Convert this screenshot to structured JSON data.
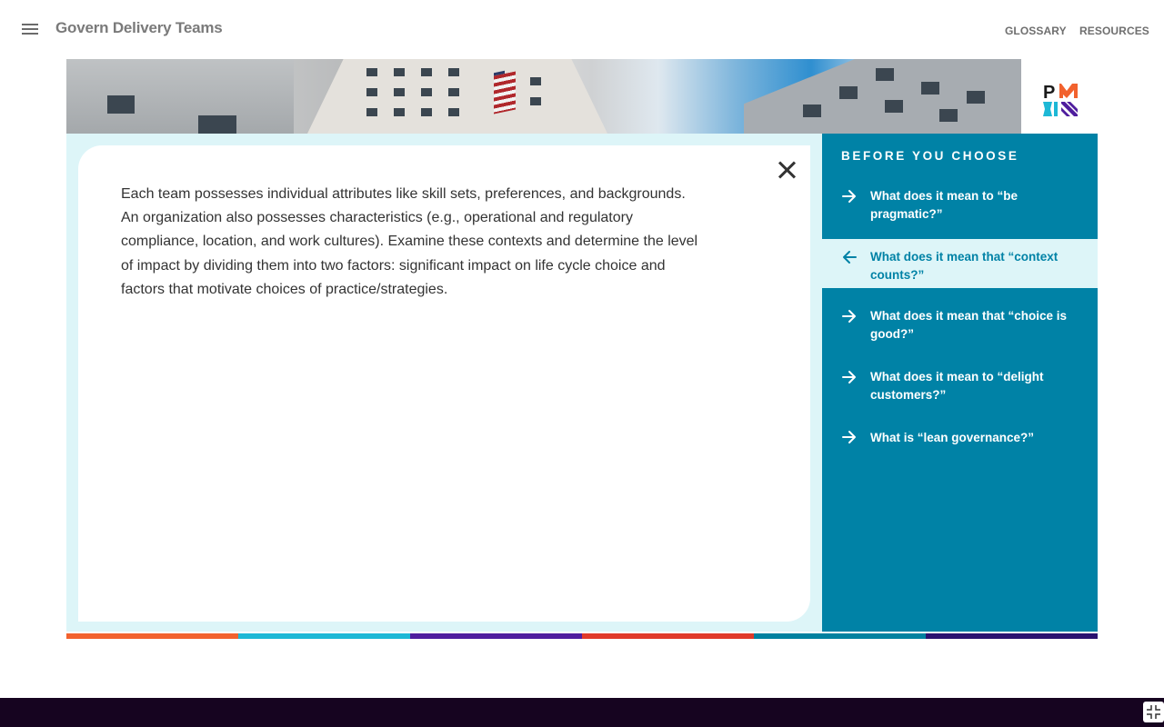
{
  "header": {
    "title": "Govern Delivery Teams",
    "menu_icon": "hamburger-menu-icon",
    "links": [
      "GLOSSARY",
      "RESOURCES"
    ]
  },
  "card": {
    "body": "Each team possesses individual attributes like skill sets, preferences, and backgrounds. An organization also possesses characteristics (e.g., operational and regulatory compliance, location, and work cultures). Examine these contexts and determine the level of impact by dividing them into two factors: significant impact on life cycle choice and factors that motivate choices of practice/strategies.",
    "close_icon": "close-icon"
  },
  "sidebar": {
    "title": "BEFORE YOU CHOOSE",
    "items": [
      {
        "label": "What does it mean to “be pragmatic?”",
        "icon": "arrow-right-icon",
        "active": false
      },
      {
        "label": "What does it mean that “context counts?”",
        "icon": "arrow-left-icon",
        "active": true
      },
      {
        "label": "What does it mean that “choice is good?”",
        "icon": "arrow-right-icon",
        "active": false
      },
      {
        "label": "What does it mean to “delight customers?”",
        "icon": "arrow-right-icon",
        "active": false
      },
      {
        "label": "What is “lean governance?”",
        "icon": "arrow-right-icon",
        "active": false
      }
    ]
  },
  "colors": {
    "accent": "#0082a6",
    "active_bg": "#ddf5f8",
    "footer": "#160420",
    "strip": [
      "#f2622e",
      "#1db8d6",
      "#4f1d9e",
      "#e03a2a",
      "#0081a0",
      "#2a1170"
    ]
  }
}
